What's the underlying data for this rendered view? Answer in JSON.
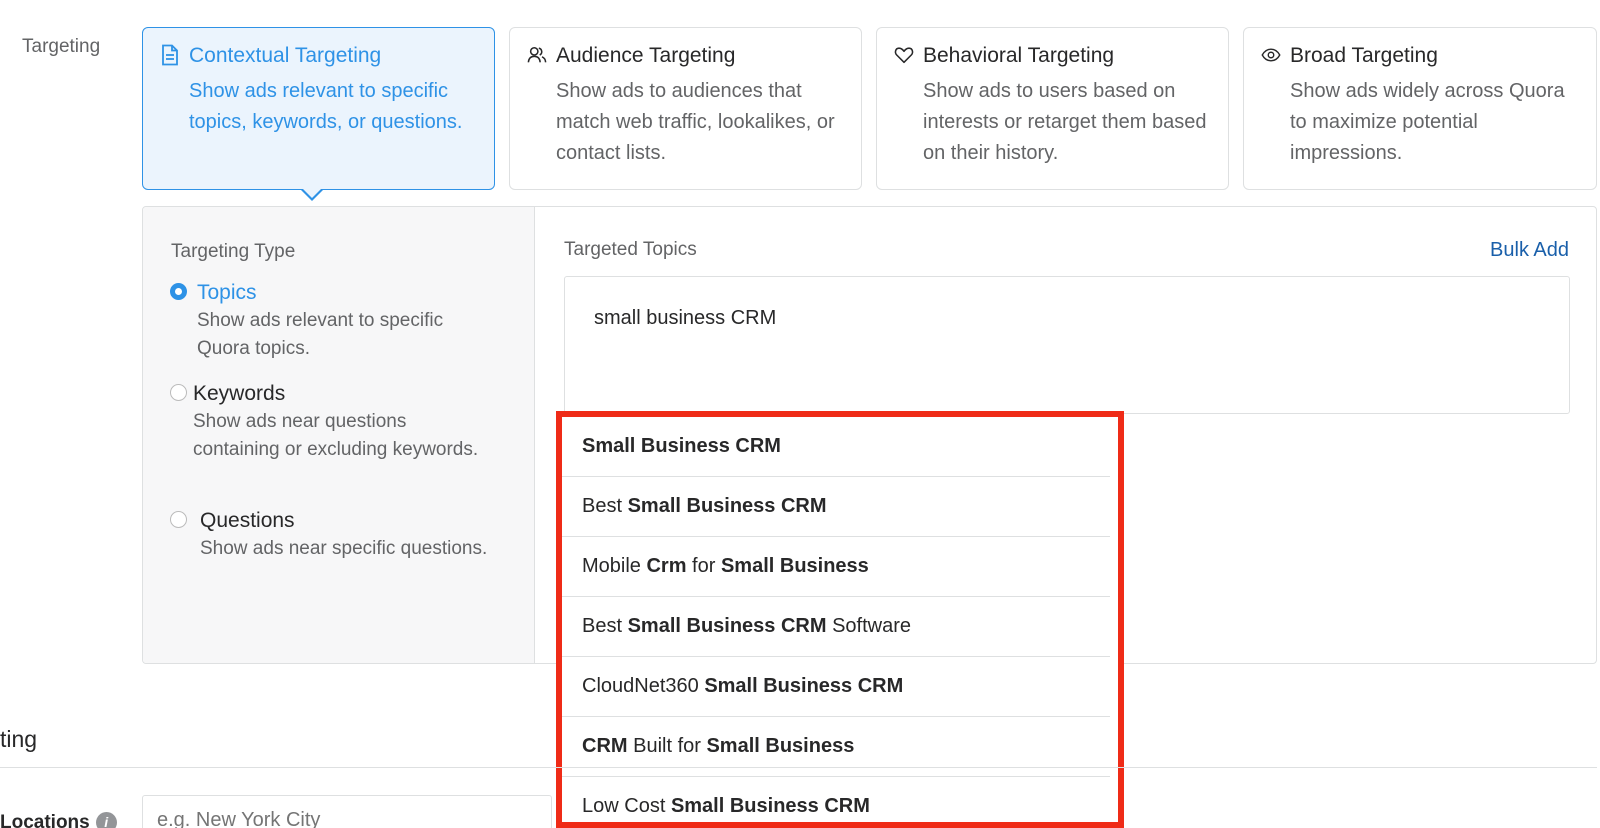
{
  "targeting_label": "Targeting",
  "type_cards": [
    {
      "icon": "document-icon",
      "title": "Contextual Targeting",
      "desc": "Show ads relevant to specific topics, keywords, or questions.",
      "active": true
    },
    {
      "icon": "people-icon",
      "title": "Audience Targeting",
      "desc": "Show ads to audiences that match web traffic, lookalikes, or contact lists.",
      "active": false
    },
    {
      "icon": "heart-icon",
      "title": "Behavioral Targeting",
      "desc": "Show ads to users based on interests or retarget them based on their history.",
      "active": false
    },
    {
      "icon": "eye-icon",
      "title": "Broad Targeting",
      "desc": "Show ads widely across Quora to maximize potential impressions.",
      "active": false
    }
  ],
  "targeting_type": {
    "heading": "Targeting Type",
    "options": [
      {
        "label": "Topics",
        "desc": "Show ads relevant to specific Quora topics.",
        "checked": true
      },
      {
        "label": "Keywords",
        "desc": "Show ads near questions containing or excluding keywords.",
        "checked": false
      },
      {
        "label": "Questions",
        "desc": "Show ads near specific questions.",
        "checked": false
      }
    ]
  },
  "topics": {
    "heading": "Targeted Topics",
    "bulk_add": "Bulk Add",
    "input_value": "small business CRM"
  },
  "suggestions": [
    [
      {
        "t": "Small Business CRM",
        "b": true
      }
    ],
    [
      {
        "t": "Best ",
        "b": false
      },
      {
        "t": "Small Business CRM",
        "b": true
      }
    ],
    [
      {
        "t": "Mobile ",
        "b": false
      },
      {
        "t": "Crm",
        "b": true
      },
      {
        "t": " for ",
        "b": false
      },
      {
        "t": "Small Business",
        "b": true
      }
    ],
    [
      {
        "t": "Best ",
        "b": false
      },
      {
        "t": "Small Business CRM",
        "b": true
      },
      {
        "t": " Software",
        "b": false
      }
    ],
    [
      {
        "t": "CloudNet360 ",
        "b": false
      },
      {
        "t": "Small Business CRM",
        "b": true
      }
    ],
    [
      {
        "t": "CRM",
        "b": true
      },
      {
        "t": " Built for ",
        "b": false
      },
      {
        "t": "Small Business",
        "b": true
      }
    ],
    [
      {
        "t": "Low Cost ",
        "b": false
      },
      {
        "t": "Small Business CRM",
        "b": true
      }
    ]
  ],
  "location_section": {
    "title": "ting",
    "locations_label": "Locations",
    "info_icon": "info-icon",
    "locations_placeholder": "e.g. New York City"
  },
  "colors": {
    "accent": "#2e92e6",
    "active_card_bg": "#ebf4fd",
    "highlight_border": "#ef2b17",
    "link": "#195faa"
  }
}
